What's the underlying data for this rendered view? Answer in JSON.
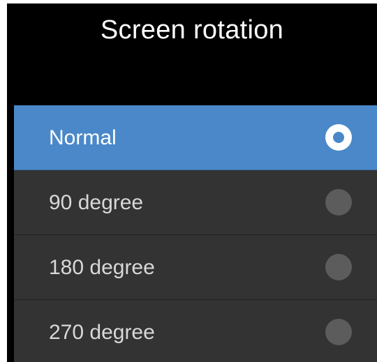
{
  "title": "Screen rotation",
  "options": [
    {
      "label": "Normal",
      "selected": true
    },
    {
      "label": "90 degree",
      "selected": false
    },
    {
      "label": "180 degree",
      "selected": false
    },
    {
      "label": "270 degree",
      "selected": false
    }
  ],
  "colors": {
    "background": "#000000",
    "selected_row": "#4a88c9",
    "list_row": "#333333",
    "radio_unselected": "#5c5c5c",
    "radio_selected": "#ffffff"
  }
}
